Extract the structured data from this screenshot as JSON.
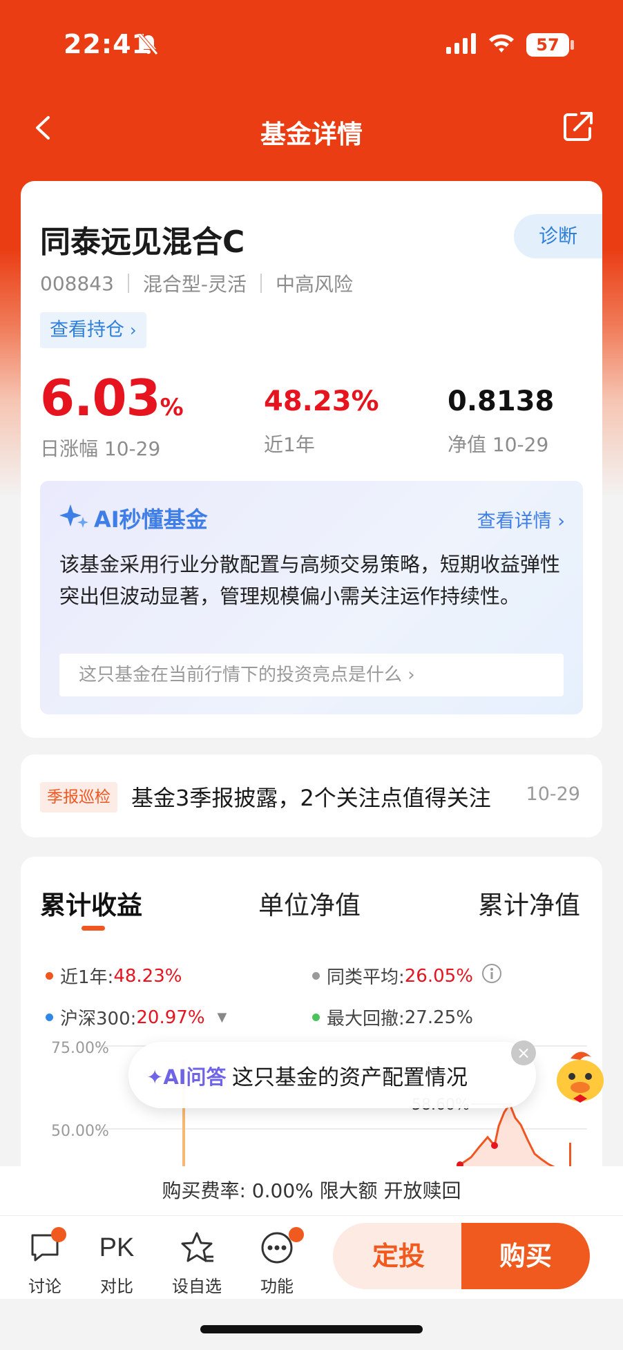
{
  "status_bar": {
    "time": "22:41",
    "battery": "57"
  },
  "nav": {
    "title": "基金详情"
  },
  "fund": {
    "name": "同泰远见混合C",
    "diagnose_label": "诊断",
    "code": "008843",
    "type": "混合型-灵活",
    "risk": "中高风险",
    "holdings_link": "查看持仓",
    "daily_change_value": "6.03",
    "daily_change_unit": "%",
    "daily_change_label": "日涨幅 10-29",
    "year_return": "48.23%",
    "year_label": "近1年",
    "nav_value": "0.8138",
    "nav_label": "净值 10-29"
  },
  "ai_summary": {
    "title": "AI秒懂基金",
    "more_link": "查看详情",
    "text": "该基金采用行业分散配置与高频交易策略，短期收益弹性突出但波动显著，管理规模偏小需关注运作持续性。",
    "question": "这只基金在当前行情下的投资亮点是什么"
  },
  "report": {
    "tag": "季报巡检",
    "title": "基金3季报披露，2个关注点值得关注",
    "date": "10-29"
  },
  "chart_tabs": [
    "累计收益",
    "单位净值",
    "累计净值"
  ],
  "legend": {
    "year": {
      "label": "近1年:",
      "value": "48.23%",
      "color": "#f0561f"
    },
    "peer": {
      "label": "同类平均:",
      "value": "26.05%",
      "color": "#9a9a9a"
    },
    "index": {
      "label": "沪深300:",
      "value": "20.97%",
      "color": "#2f87e8"
    },
    "drawdown": {
      "label": "最大回撤:",
      "value": "27.25%",
      "color": "#4cc25b"
    }
  },
  "chart_data": {
    "type": "line",
    "y_ticks": [
      "75.00%",
      "50.00%"
    ],
    "peak_label": "58.60%",
    "ylim": [
      0,
      75
    ],
    "grid": true
  },
  "float_ai": {
    "label": "AI问答",
    "text": "这只基金的资产配置情况"
  },
  "fee_bar": {
    "text": "购买费率:  0.00%  限大额  开放赎回"
  },
  "bottom_bar": {
    "discuss": "讨论",
    "compare_icon": "PK",
    "compare": "对比",
    "watchlist": "设自选",
    "features": "功能",
    "invest": "定投",
    "buy": "购买"
  }
}
